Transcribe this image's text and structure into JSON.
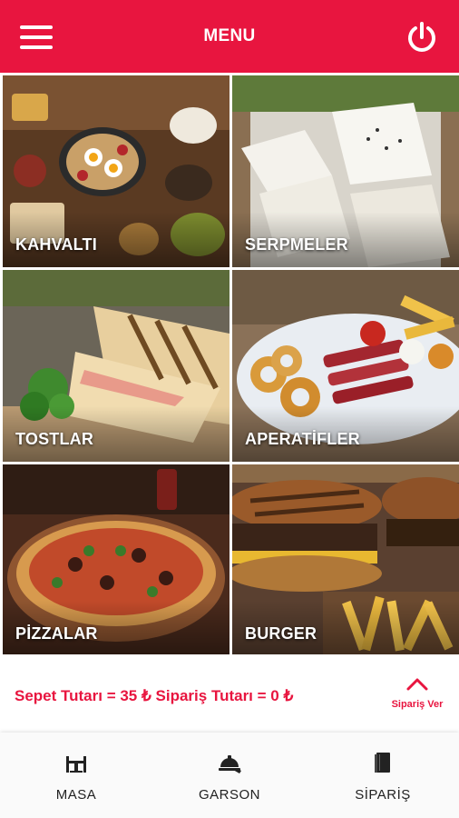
{
  "header": {
    "title": "MENU",
    "menu_icon": "hamburger-icon",
    "power_icon": "power-icon",
    "color": "#e8153f"
  },
  "categories": [
    {
      "label": "KAHVALTI"
    },
    {
      "label": "SERPMELER"
    },
    {
      "label": "TOSTLAR"
    },
    {
      "label": "APERATİFLER"
    },
    {
      "label": "PİZZALAR"
    },
    {
      "label": "BURGER"
    }
  ],
  "cart": {
    "summary": "Sepet Tutarı = 35 ₺ Sipariş Tutarı = 0 ₺",
    "order_label": "Sipariş Ver",
    "order_icon": "chevron-up-icon"
  },
  "bottom_nav": [
    {
      "label": "MASA",
      "icon": "table-icon"
    },
    {
      "label": "GARSON",
      "icon": "waiter-icon"
    },
    {
      "label": "SİPARİŞ",
      "icon": "menu-book-icon"
    }
  ]
}
